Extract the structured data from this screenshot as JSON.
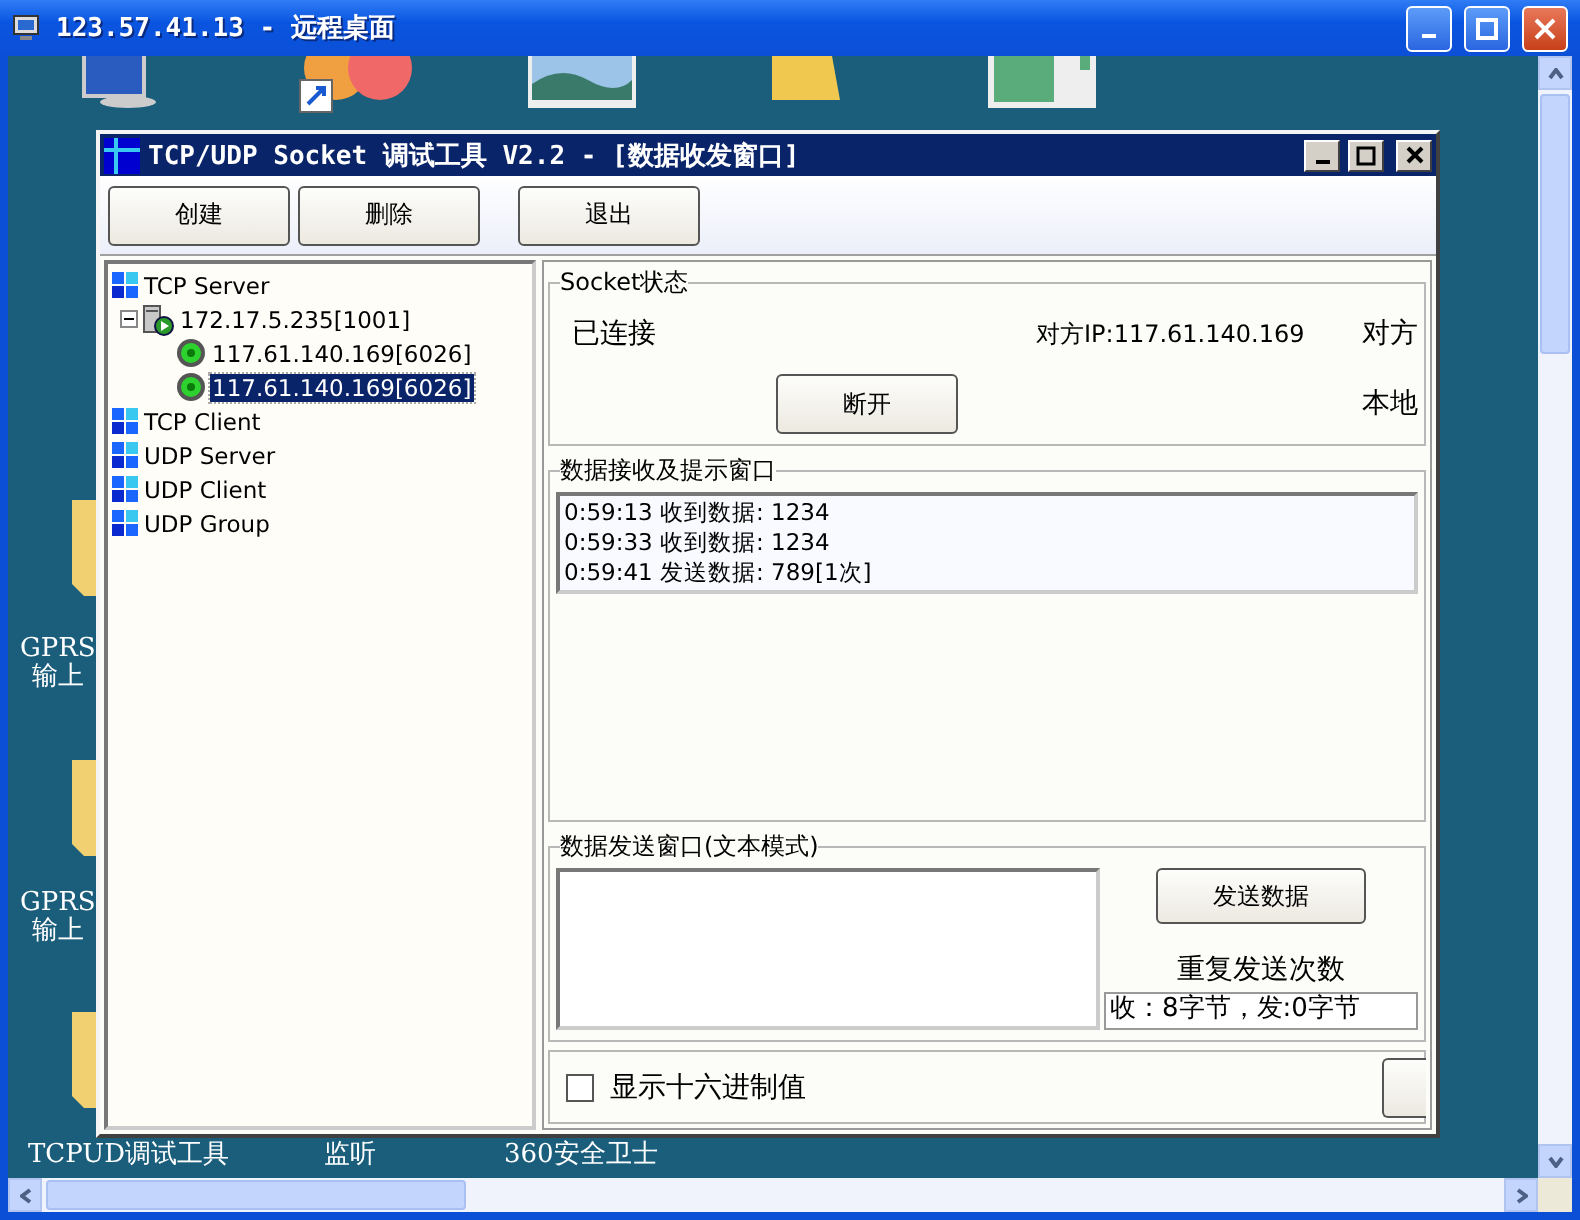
{
  "remote_window": {
    "title": "123.57.41.13 - 远程桌面"
  },
  "left_icons": [
    {
      "lines": [
        "GPRS",
        "输上"
      ]
    },
    {
      "lines": [
        "GPRS",
        "输上"
      ]
    }
  ],
  "bottom_labels": [
    "TCPUD调试工具",
    "监听",
    "360安全卫士"
  ],
  "app": {
    "title": "TCP/UDP Socket 调试工具 V2.2 - [数据收发窗口]",
    "toolbar": [
      "创建",
      "删除",
      "退出"
    ],
    "tree": [
      {
        "label": "TCP Server",
        "kind": "category",
        "selected": false,
        "children": [
          {
            "label": "172.17.5.235[1001]",
            "kind": "server",
            "selected": false,
            "expanded": true,
            "children": [
              {
                "label": "117.61.140.169[6026]",
                "kind": "connection",
                "selected": false
              },
              {
                "label": "117.61.140.169[6026]",
                "kind": "connection",
                "selected": true
              }
            ]
          }
        ]
      },
      {
        "label": "TCP Client",
        "kind": "category",
        "selected": false
      },
      {
        "label": "UDP Server",
        "kind": "category",
        "selected": false
      },
      {
        "label": "UDP Client",
        "kind": "category",
        "selected": false
      },
      {
        "label": "UDP Group",
        "kind": "category",
        "selected": false
      }
    ],
    "socket_status": {
      "title": "Socket状态",
      "state": "已连接",
      "peer_ip": "对方IP:117.61.140.169",
      "peer_port": "对方",
      "disconnect": "断开",
      "local": "本地"
    },
    "receive": {
      "title": "数据接收及提示窗口",
      "lines": [
        "0:59:13 收到数据: 1234",
        "0:59:33 收到数据: 1234",
        "0:59:41 发送数据: 789[1次]"
      ]
    },
    "send": {
      "title": "数据发送窗口(文本模式)",
      "send_button": "发送数据",
      "repeat_label": "重复发送次数",
      "counter": "收：8字节，发:0字节"
    },
    "hex_option": {
      "label": "显示十六进制值",
      "checked": false
    }
  }
}
